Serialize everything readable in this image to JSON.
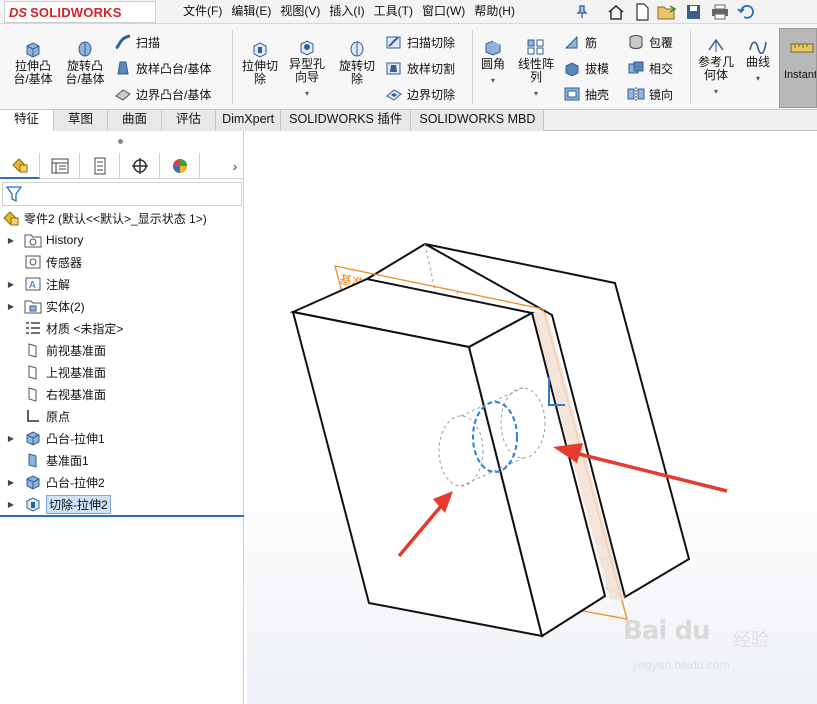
{
  "app": {
    "logo_prefix": "DS",
    "logo_name": "SOLIDWORKS",
    "brand_color": "#d2232a"
  },
  "menu": [
    "文件(F)",
    "编辑(E)",
    "视图(V)",
    "插入(I)",
    "工具(T)",
    "窗口(W)",
    "帮助(H)"
  ],
  "title_icons": [
    "pin-icon",
    "home-icon",
    "new-file-icon",
    "open-icon",
    "save-icon",
    "print-icon",
    "undo-icon"
  ],
  "ribbon": {
    "extrude_boss": "拉伸凸\n台/基体",
    "revolve_boss": "旋转凸\n台/基体",
    "sweep": "扫描",
    "loft": "放样凸台/基体",
    "boundary_boss": "边界凸台/基体",
    "extrude_cut": "拉伸切\n除",
    "hole_wizard": "异型孔\n向导",
    "revolve_cut": "旋转切\n除",
    "sweep_cut": "扫描切除",
    "loft_cut": "放样切割",
    "boundary_cut": "边界切除",
    "fillet": "圆角",
    "linear_pattern": "线性阵\n列",
    "rib": "筋",
    "draft": "拔模",
    "shell": "抽壳",
    "wrap": "包覆",
    "intersect": "相交",
    "mirror": "镜向",
    "ref_geometry": "参考几\n何体",
    "curves": "曲线",
    "instant3d": "Instant"
  },
  "tabs": [
    "特征",
    "草图",
    "曲面",
    "评估",
    "DimXpert",
    "SOLIDWORKS 插件",
    "SOLIDWORKS MBD"
  ],
  "panel_tabs": [
    "featuremanager-icon",
    "propertymanager-icon",
    "configuration-icon",
    "dimxpert-icon",
    "appearance-icon"
  ],
  "tree": {
    "root": "零件2 (默认<<默认>_显示状态 1>)",
    "items": [
      {
        "label": "History",
        "expandable": true
      },
      {
        "label": "传感器",
        "expandable": false
      },
      {
        "label": "注解",
        "expandable": true
      },
      {
        "label": "实体(2)",
        "expandable": true
      },
      {
        "label": "材质 <未指定>",
        "expandable": false
      },
      {
        "label": "前视基准面",
        "expandable": false
      },
      {
        "label": "上视基准面",
        "expandable": false
      },
      {
        "label": "右视基准面",
        "expandable": false
      },
      {
        "label": "原点",
        "expandable": false
      },
      {
        "label": "凸台-拉伸1",
        "expandable": true
      },
      {
        "label": "基准面1",
        "expandable": false
      },
      {
        "label": "凸台-拉伸2",
        "expandable": true
      },
      {
        "label": "切除-拉伸2",
        "expandable": true
      }
    ]
  },
  "viewport": {
    "plane_label": "基准面1",
    "plane_color": "#f08a24",
    "arrow_color": "#e8392f",
    "selection_color": "#2a7fd4"
  },
  "watermark": {
    "brand": "Bai du",
    "cn": "经验",
    "url": "jingyan.baidu.com"
  }
}
